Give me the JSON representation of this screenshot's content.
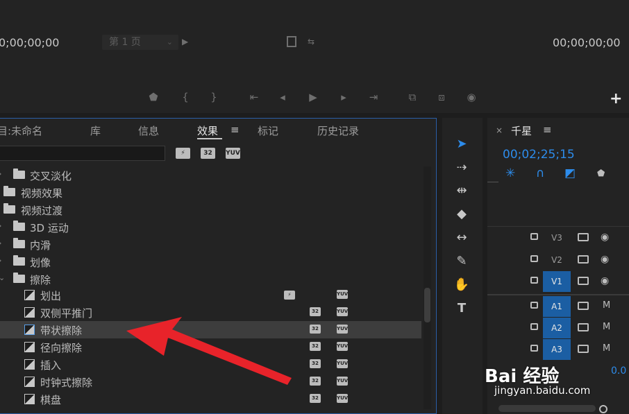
{
  "monitor": {
    "timecode_left": "0;00;00;00",
    "timecode_right": "00;00;00;00",
    "page_select": "第 1 页",
    "controls": [
      "marker-icon",
      "mark-in-icon",
      "mark-out-icon",
      "go-to-in-icon",
      "step-back-icon",
      "play-icon",
      "step-forward-icon",
      "go-to-out-icon",
      "insert-icon",
      "overwrite-icon",
      "camera-icon",
      "add-icon"
    ]
  },
  "effects_panel": {
    "tabs": [
      {
        "label": "目:未命名"
      },
      {
        "label": "库"
      },
      {
        "label": "信息"
      },
      {
        "label": "效果"
      },
      {
        "label": "标记"
      },
      {
        "label": "历史记录"
      }
    ],
    "active_tab": "效果",
    "tab_menu": "≡",
    "filter_badges": [
      "accelerated-effects-icon",
      "32",
      "YUV"
    ],
    "tree": [
      {
        "label": "交叉淡化",
        "type": "folder",
        "expanded": false
      },
      {
        "label": "视频效果",
        "type": "folder",
        "expanded": false
      },
      {
        "label": "视频过渡",
        "type": "folder",
        "expanded": true
      },
      {
        "label": "3D 运动",
        "type": "folder",
        "expanded": false
      },
      {
        "label": "内滑",
        "type": "folder",
        "expanded": false
      },
      {
        "label": "划像",
        "type": "folder",
        "expanded": false
      },
      {
        "label": "擦除",
        "type": "folder",
        "expanded": true
      },
      {
        "label": "划出",
        "type": "effect",
        "badges": [
          "accelerated",
          "YUV"
        ]
      },
      {
        "label": "双侧平推门",
        "type": "effect",
        "badges": [
          "32",
          "YUV"
        ]
      },
      {
        "label": "带状擦除",
        "type": "effect",
        "badges": [
          "32",
          "YUV"
        ],
        "selected": true
      },
      {
        "label": "径向擦除",
        "type": "effect",
        "badges": [
          "32",
          "YUV"
        ]
      },
      {
        "label": "插入",
        "type": "effect",
        "badges": [
          "32",
          "YUV"
        ]
      },
      {
        "label": "时钟式擦除",
        "type": "effect",
        "badges": [
          "32",
          "YUV"
        ]
      },
      {
        "label": "棋盘",
        "type": "effect",
        "badges": [
          "32",
          "YUV"
        ]
      }
    ]
  },
  "tools": [
    "selection-tool-icon",
    "track-select-icon",
    "ripple-edit-icon",
    "razor-icon",
    "slip-icon",
    "pen-icon",
    "hand-icon",
    "type-icon"
  ],
  "timeline": {
    "close": "×",
    "title": "千星",
    "menu": "≡",
    "timecode": "00;02;25;15",
    "tracks": [
      {
        "label": "V3",
        "on": false,
        "kind": "video"
      },
      {
        "label": "V2",
        "on": false,
        "kind": "video"
      },
      {
        "label": "V1",
        "on": true,
        "kind": "video"
      },
      {
        "label": "A1",
        "on": true,
        "kind": "audio",
        "m": "M"
      },
      {
        "label": "A2",
        "on": true,
        "kind": "audio",
        "m": "M"
      },
      {
        "label": "A3",
        "on": true,
        "kind": "audio",
        "m": "M"
      }
    ],
    "volume": "0.0"
  },
  "watermark": {
    "brand": "Bai 经验",
    "url": "jingyan.baidu.com"
  },
  "colors": {
    "accent": "#2d8ceb",
    "track_on": "#1b5ea3",
    "panel_focus": "#2b5fa8",
    "arrow": "#e8232a"
  }
}
